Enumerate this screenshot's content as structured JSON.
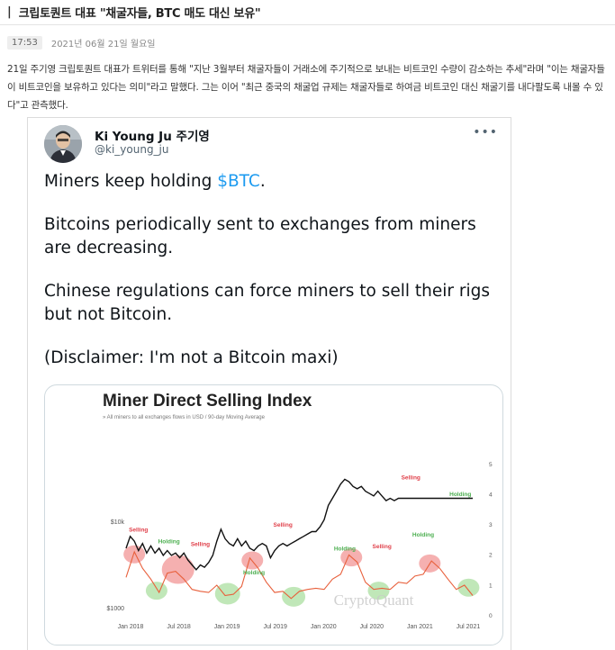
{
  "header": {
    "bar": "|",
    "title": "크립토퀀트 대표 \"채굴자들, BTC 매도 대신 보유\""
  },
  "meta": {
    "time": "17:53",
    "date": "2021년 06월 21일 월요일"
  },
  "article": {
    "body": "21일 주기영 크립토퀀트 대표가 트위터를 통해 \"지난 3월부터 채굴자들이 거래소에 주기적으로 보내는 비트코인 수량이 감소하는 추세\"라며 \"이는 채굴자들이 비트코인을 보유하고 있다는 의미\"라고 말했다. 그는 이어 \"최근 중국의 채굴업 규제는 채굴자들로 하여금 비트코인 대신 채굴기를 내다팔도록 내몰 수 있다\"고 관측했다."
  },
  "tweet": {
    "author_name": "Ki Young Ju 주기영",
    "author_handle": "@ki_young_ju",
    "more": "•••",
    "line1_prefix": "Miners keep holding ",
    "cashtag": "$BTC",
    "line1_suffix": ".",
    "line2": "Bitcoins periodically sent to exchanges from miners are decreasing.",
    "line3": "Chinese regulations can force miners to sell their rigs but not Bitcoin.",
    "line4": "(Disclaimer: I'm not a Bitcoin maxi)"
  },
  "chart_data": {
    "type": "line",
    "title": "Miner Direct Selling Index",
    "subtitle": "All miners to all exchanges flows in USD / 90-day Moving Average",
    "watermark": "CryptoQuant",
    "x_ticks": [
      "Jan 2018",
      "Jul 2018",
      "Jan 2019",
      "Jul 2019",
      "Jan 2020",
      "Jul 2020",
      "Jan 2021",
      "Jul 2021"
    ],
    "y_left_ticks": [
      "$1000",
      "$10k"
    ],
    "y_right_ticks": [
      "0",
      "1",
      "2",
      "3",
      "4",
      "5"
    ],
    "colors": {
      "price": "#111111",
      "index": "#e8603c",
      "selling": "#e0404a",
      "holding": "#4caf50",
      "selling_fill": "#f4a7a7",
      "holding_fill": "#b9e4b0"
    },
    "series": [
      {
        "name": "BTC Price",
        "axis": "left",
        "x": [
          0,
          0.5,
          1,
          1.5,
          2,
          2.5,
          3,
          3.5,
          4,
          4.5,
          5,
          5.5,
          6,
          6.5,
          7,
          7.5,
          8,
          8.5,
          9,
          9.5,
          10,
          10.5,
          11,
          11.5,
          12,
          12.5,
          13,
          13.5,
          14,
          14.5,
          15,
          15.5,
          16,
          16.5,
          17,
          17.5,
          18,
          18.5,
          19,
          19.5,
          20,
          20.5,
          21,
          21.5,
          22,
          22.5,
          23,
          23.5,
          24,
          24.5,
          25,
          25.5,
          26,
          26.5,
          27,
          27.5,
          28,
          28.5,
          29,
          29.5,
          30,
          30.5,
          31,
          31.5,
          32,
          32.5,
          33,
          33.5,
          34,
          34.5,
          35,
          35.5,
          36,
          36.5,
          37,
          37.5,
          38,
          38.5,
          39,
          39.5,
          40,
          40.5,
          41,
          41.5,
          42
        ],
        "values": [
          2.8,
          3.3,
          3.1,
          2.7,
          3.0,
          2.6,
          2.9,
          2.6,
          2.8,
          2.5,
          2.7,
          2.5,
          2.6,
          2.4,
          2.6,
          2.3,
          2.1,
          1.9,
          2.1,
          2.0,
          2.2,
          2.5,
          3.1,
          3.6,
          3.2,
          3.0,
          2.9,
          3.2,
          2.9,
          3.1,
          2.8,
          2.7,
          2.9,
          3.0,
          2.9,
          2.4,
          2.7,
          2.9,
          3.0,
          2.9,
          3.0,
          3.1,
          3.2,
          3.3,
          3.4,
          3.5,
          3.5,
          3.7,
          4.0,
          4.6,
          4.9,
          5.2,
          5.5,
          5.7,
          5.6,
          5.4,
          5.3,
          5.4,
          5.2,
          5.1,
          5.0,
          5.2,
          5.0,
          4.8,
          4.9,
          4.8,
          4.9,
          4.9,
          4.9,
          4.9,
          4.9,
          4.9,
          4.9,
          4.9,
          4.9,
          4.9,
          4.9,
          4.9,
          4.9,
          4.9,
          4.9,
          4.9,
          4.9,
          4.9,
          4.9
        ]
      },
      {
        "name": "Miner Direct Selling Index",
        "axis": "right",
        "x": [
          0,
          1,
          2,
          3,
          4,
          5,
          6,
          7,
          8,
          9,
          10,
          11,
          12,
          13,
          14,
          15,
          16,
          17,
          18,
          19,
          20,
          21,
          22,
          23,
          24,
          25,
          26,
          27,
          28,
          29,
          30,
          31,
          32,
          33,
          34,
          35,
          36,
          37,
          38,
          39,
          40,
          41,
          42
        ],
        "values": [
          1.3,
          2.0,
          1.6,
          1.1,
          0.8,
          1.3,
          1.5,
          1.1,
          0.9,
          0.7,
          0.8,
          0.9,
          0.7,
          0.6,
          1.0,
          1.8,
          1.6,
          1.0,
          0.8,
          0.7,
          0.6,
          0.7,
          0.9,
          0.8,
          0.9,
          1.1,
          1.4,
          1.9,
          1.8,
          1.0,
          0.9,
          0.8,
          0.9,
          1.0,
          1.1,
          1.2,
          1.4,
          1.7,
          1.6,
          1.1,
          0.9,
          0.9,
          0.7
        ]
      }
    ],
    "annotations": [
      {
        "label": "Selling",
        "kind": "selling"
      },
      {
        "label": "Holding",
        "kind": "holding"
      },
      {
        "label": "Selling",
        "kind": "selling"
      },
      {
        "label": "Holding",
        "kind": "holding"
      },
      {
        "label": "Selling",
        "kind": "selling"
      },
      {
        "label": "Holding",
        "kind": "holding"
      },
      {
        "label": "Selling",
        "kind": "selling"
      },
      {
        "label": "Holding",
        "kind": "holding"
      },
      {
        "label": "Selling",
        "kind": "selling"
      },
      {
        "label": "Holding",
        "kind": "holding"
      }
    ]
  }
}
